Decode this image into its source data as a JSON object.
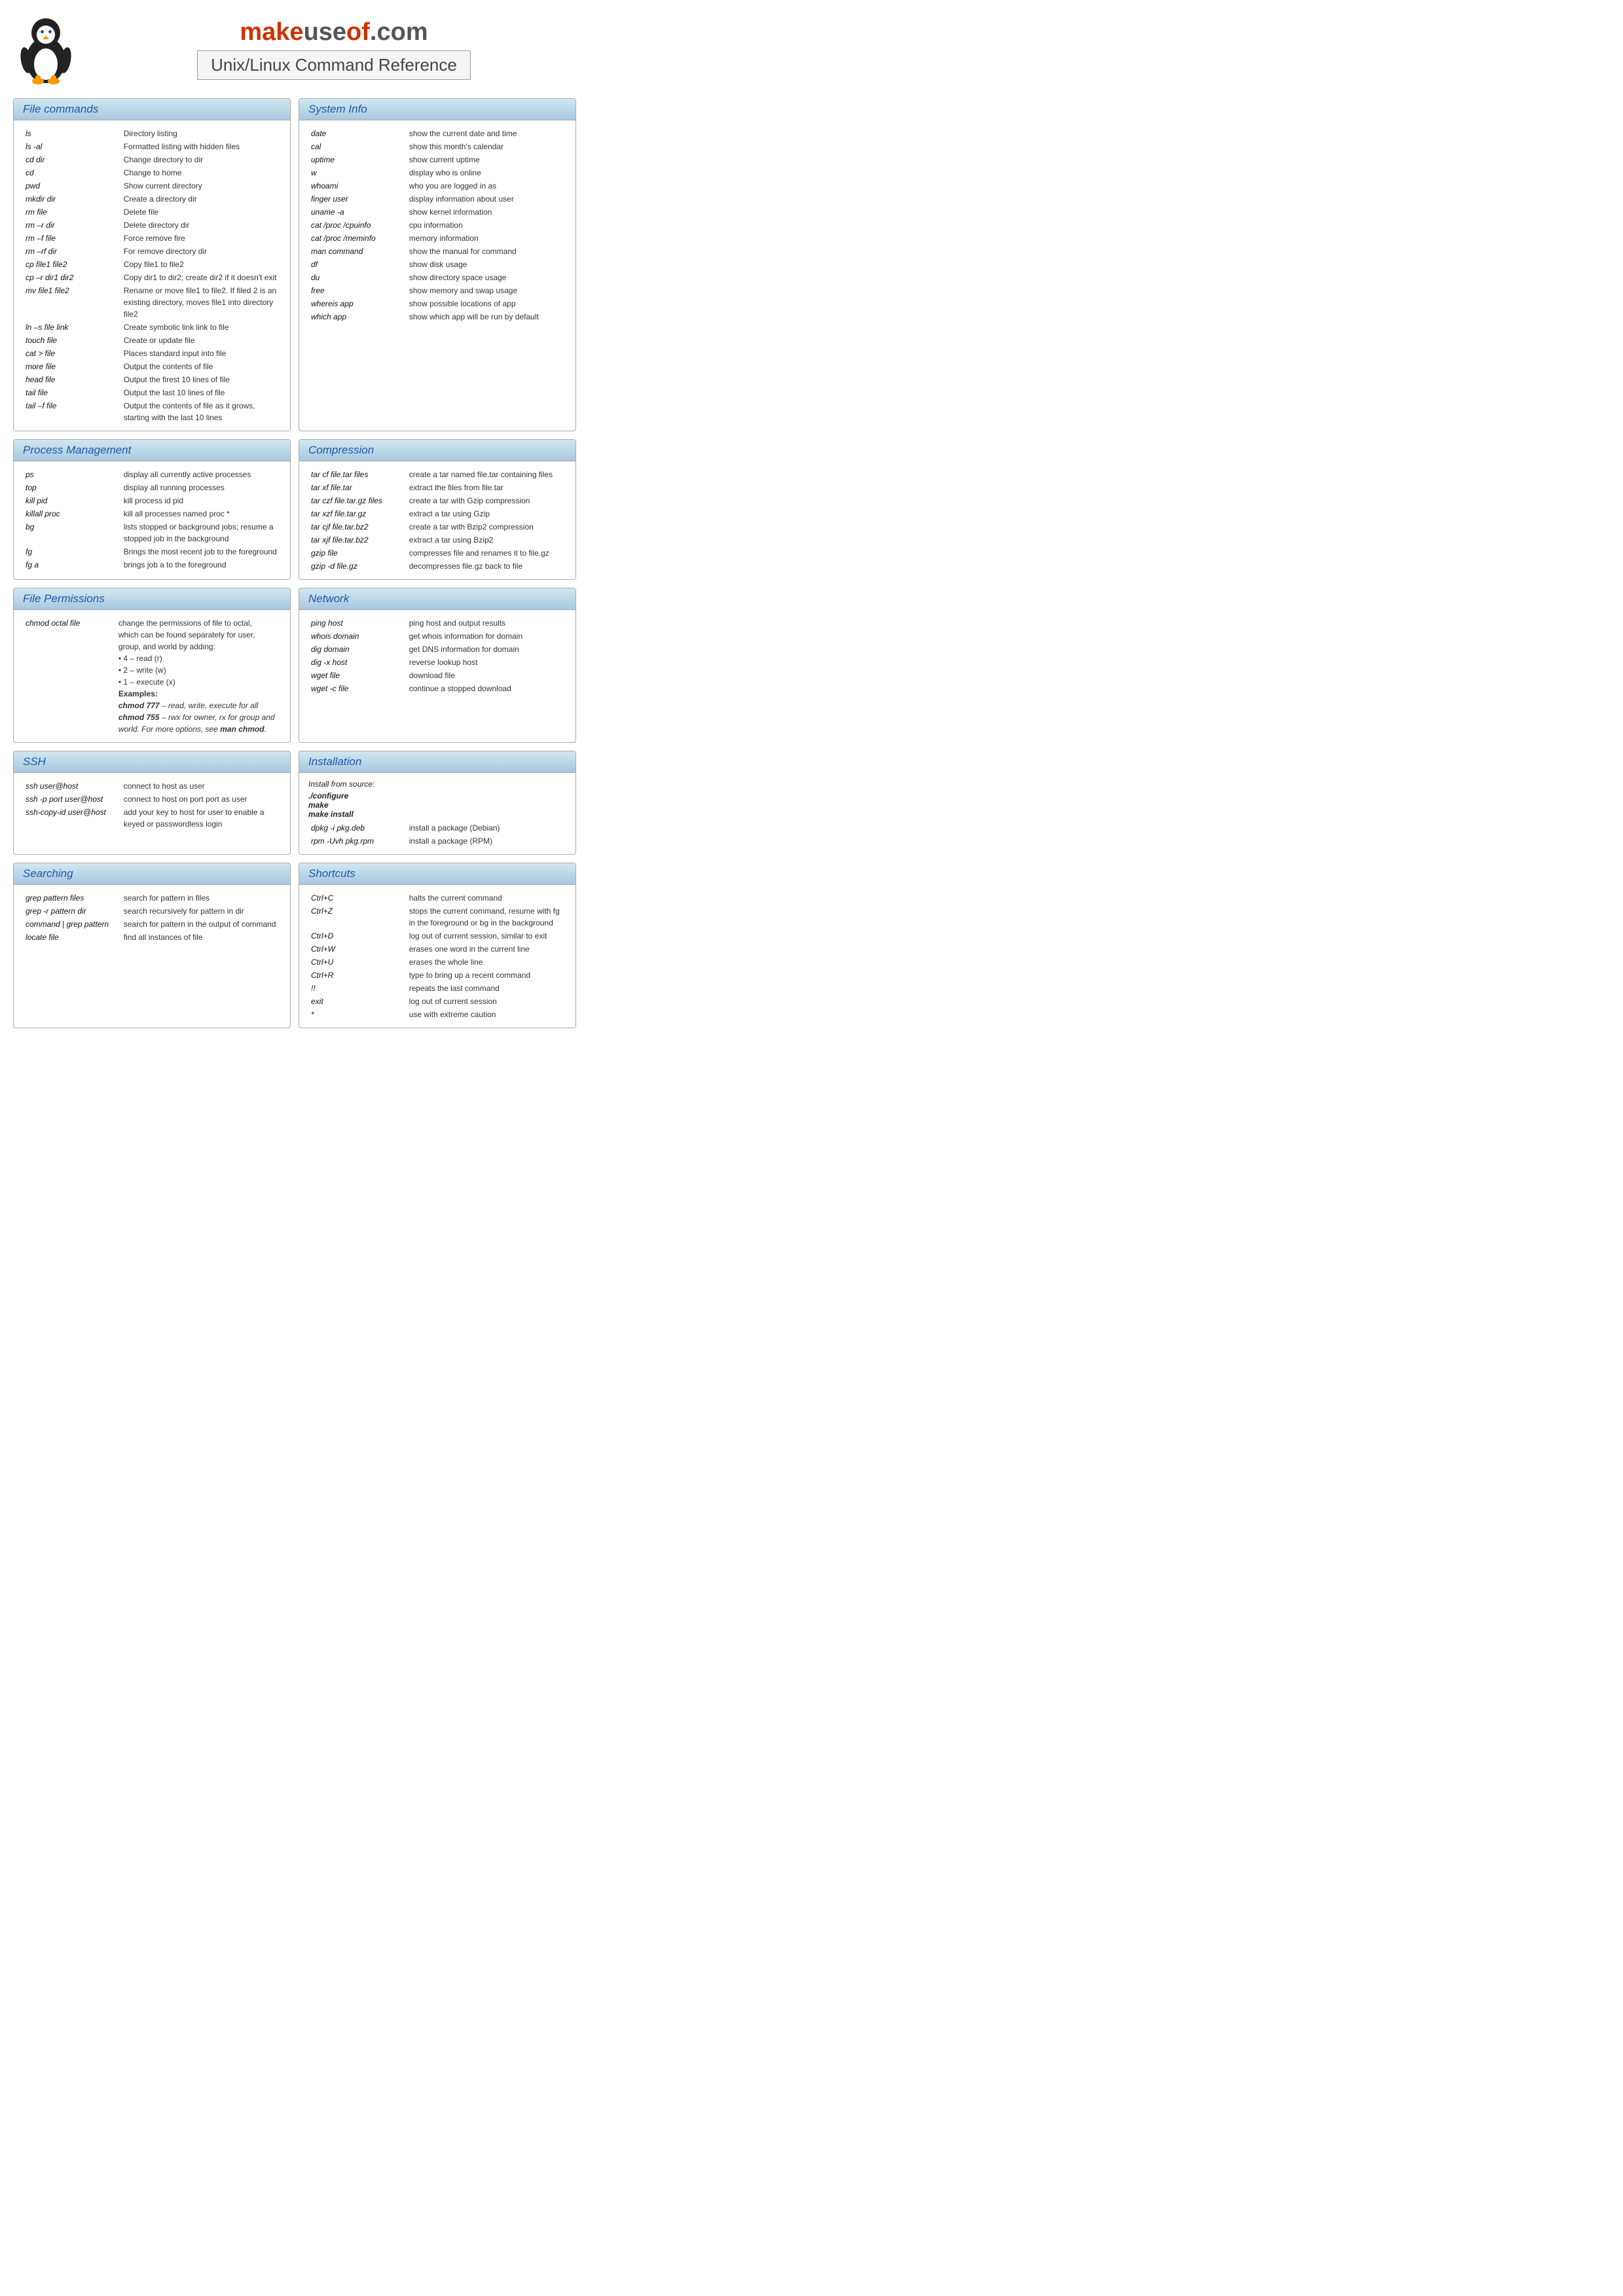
{
  "header": {
    "brand": "makeuseof.com",
    "subtitle": "Unix/Linux Command Reference"
  },
  "sections": {
    "file_commands": {
      "title": "File commands",
      "commands": [
        [
          "ls",
          "Directory listing"
        ],
        [
          "ls -al",
          "Formatted listing with hidden files"
        ],
        [
          "cd dir",
          "Change directory to dir"
        ],
        [
          "cd",
          "Change to home"
        ],
        [
          "pwd",
          "Show current directory"
        ],
        [
          "mkdir dir",
          "Create a directory dir"
        ],
        [
          "rm file",
          "Delete file"
        ],
        [
          "rm –r dir",
          "Delete directory dir"
        ],
        [
          "rm –f file",
          "Force remove fire"
        ],
        [
          "rm –rf dir",
          "For remove directory dir"
        ],
        [
          "cp file1 file2",
          "Copy file1 to file2"
        ],
        [
          "cp –r dir1 dir2",
          "Copy dir1 to dir2; create dir2 if it doesn't exit"
        ],
        [
          "mv file1 file2",
          "Rename or move file1 to file2. If filed 2 is an existing directory, moves file1 into directory file2"
        ],
        [
          "ln –s file link",
          "Create symbolic link link to file"
        ],
        [
          "touch file",
          "Create or update file"
        ],
        [
          "cat > file",
          "Places standard input into file"
        ],
        [
          "more file",
          "Output the contents of file"
        ],
        [
          "head file",
          "Output the firest 10 lines of file"
        ],
        [
          "tail file",
          "Output the last 10 lines of file"
        ],
        [
          "tail –f file",
          "Output the contents of file as it grows, starting with the last 10 lines"
        ]
      ]
    },
    "system_info": {
      "title": "System Info",
      "commands": [
        [
          "date",
          "show the current date and time"
        ],
        [
          "cal",
          "show this month's calendar"
        ],
        [
          "uptime",
          "show current uptime"
        ],
        [
          "w",
          "display who is online"
        ],
        [
          "whoami",
          "who you are logged in as"
        ],
        [
          "finger user",
          "display information about user"
        ],
        [
          "uname -a",
          "show kernel information"
        ],
        [
          "cat /proc /cpuinfo",
          "cpu information"
        ],
        [
          "cat /proc /meminfo",
          "memory information"
        ],
        [
          "man command",
          "show the manual for command"
        ],
        [
          "df",
          "show disk usage"
        ],
        [
          "du",
          "show directory space usage"
        ],
        [
          "free",
          "show memory and swap usage"
        ],
        [
          "whereis app",
          "show possible locations of app"
        ],
        [
          "which app",
          "show which app will be run by default"
        ]
      ]
    },
    "process_management": {
      "title": "Process Management",
      "commands": [
        [
          "ps",
          "display all currently active processes"
        ],
        [
          "top",
          "display all running processes"
        ],
        [
          "kill pid",
          "kill process id pid"
        ],
        [
          "killall proc",
          "kill all processes named proc *"
        ],
        [
          "bg",
          "lists stopped or background jobs; resume a stopped job in the background"
        ],
        [
          "fg",
          "Brings the most recent job to the foreground"
        ],
        [
          "fg a",
          "brings job a to the foreground"
        ]
      ]
    },
    "compression": {
      "title": "Compression",
      "commands": [
        [
          "tar cf file.tar files",
          "create a tar named file.tar containing files"
        ],
        [
          "tar xf file.tar",
          "extract the files from file.tar"
        ],
        [
          "tar czf file.tar.gz files",
          "create a tar with Gzip compression"
        ],
        [
          "tar xzf file.tar.gz",
          "extract a tar using Gzip"
        ],
        [
          "tar cjf file.tar.bz2",
          "create a tar with Bzip2 compression"
        ],
        [
          "tar xjf file.tar.bz2",
          "extract a tar using Bzip2"
        ],
        [
          "gzip file",
          "compresses file and renames it to file.gz"
        ],
        [
          "gzip -d file.gz",
          "decompresses file.gz back to file"
        ]
      ]
    },
    "file_permissions": {
      "title": "File Permissions",
      "cmd": "chmod octal file",
      "desc_lines": [
        "change the permissions of file to octal,",
        "which can be found separately for user,",
        "group, and world by adding:",
        "• 4 – read (r)",
        "• 2 – write (w)",
        "• 1 – execute (x)",
        "Examples:",
        "chmod 777 – read, write, execute for all",
        "chmod 755 – rwx for owner, rx for group and world. For more options, see man chmod."
      ]
    },
    "network": {
      "title": "Network",
      "commands": [
        [
          "ping host",
          "ping host and output results"
        ],
        [
          "whois domain",
          "get whois information for domain"
        ],
        [
          "dig domain",
          "get DNS information for domain"
        ],
        [
          "dig -x host",
          "reverse lookup host"
        ],
        [
          "wget file",
          "download file"
        ],
        [
          "wget -c file",
          "continue a stopped download"
        ]
      ]
    },
    "ssh": {
      "title": "SSH",
      "commands": [
        [
          "ssh user@host",
          "connect to host as user"
        ],
        [
          "ssh -p port user@host",
          "connect to host on port port as user"
        ],
        [
          "ssh-copy-id user@host",
          "add your key to host for user to enable a keyed or passwordless login"
        ]
      ]
    },
    "installation": {
      "title": "Installation",
      "intro": "Install from source:",
      "source_commands": [
        "./configure",
        "make",
        "make install"
      ],
      "pkg_commands": [
        [
          "dpkg -i pkg.deb",
          "install a package (Debian)"
        ],
        [
          "rpm -Uvh pkg.rpm",
          "install a package (RPM)"
        ]
      ]
    },
    "searching": {
      "title": "Searching",
      "commands": [
        [
          "grep pattern files",
          "search for pattern in files"
        ],
        [
          "grep -r pattern dir",
          "search recursively for pattern in dir"
        ],
        [
          "command | grep pattern",
          "search for pattern in the output of command"
        ],
        [
          "locate file",
          "find all instances of file"
        ]
      ]
    },
    "shortcuts": {
      "title": "Shortcuts",
      "commands": [
        [
          "Ctrl+C",
          "halts the current command"
        ],
        [
          "Ctrl+Z",
          "stops the current command, resume with fg in the foreground or bg in the background"
        ],
        [
          "Ctrl+D",
          "log out of current session, similar to exit"
        ],
        [
          "Ctrl+W",
          "erases one word in the current line"
        ],
        [
          "Ctrl+U",
          "erases the whole line"
        ],
        [
          "Ctrl+R",
          "type to bring up a recent command"
        ],
        [
          "!!",
          "repeats the last command"
        ],
        [
          "exit",
          "log out of current session"
        ],
        [
          "*",
          "use with extreme caution"
        ]
      ]
    }
  }
}
